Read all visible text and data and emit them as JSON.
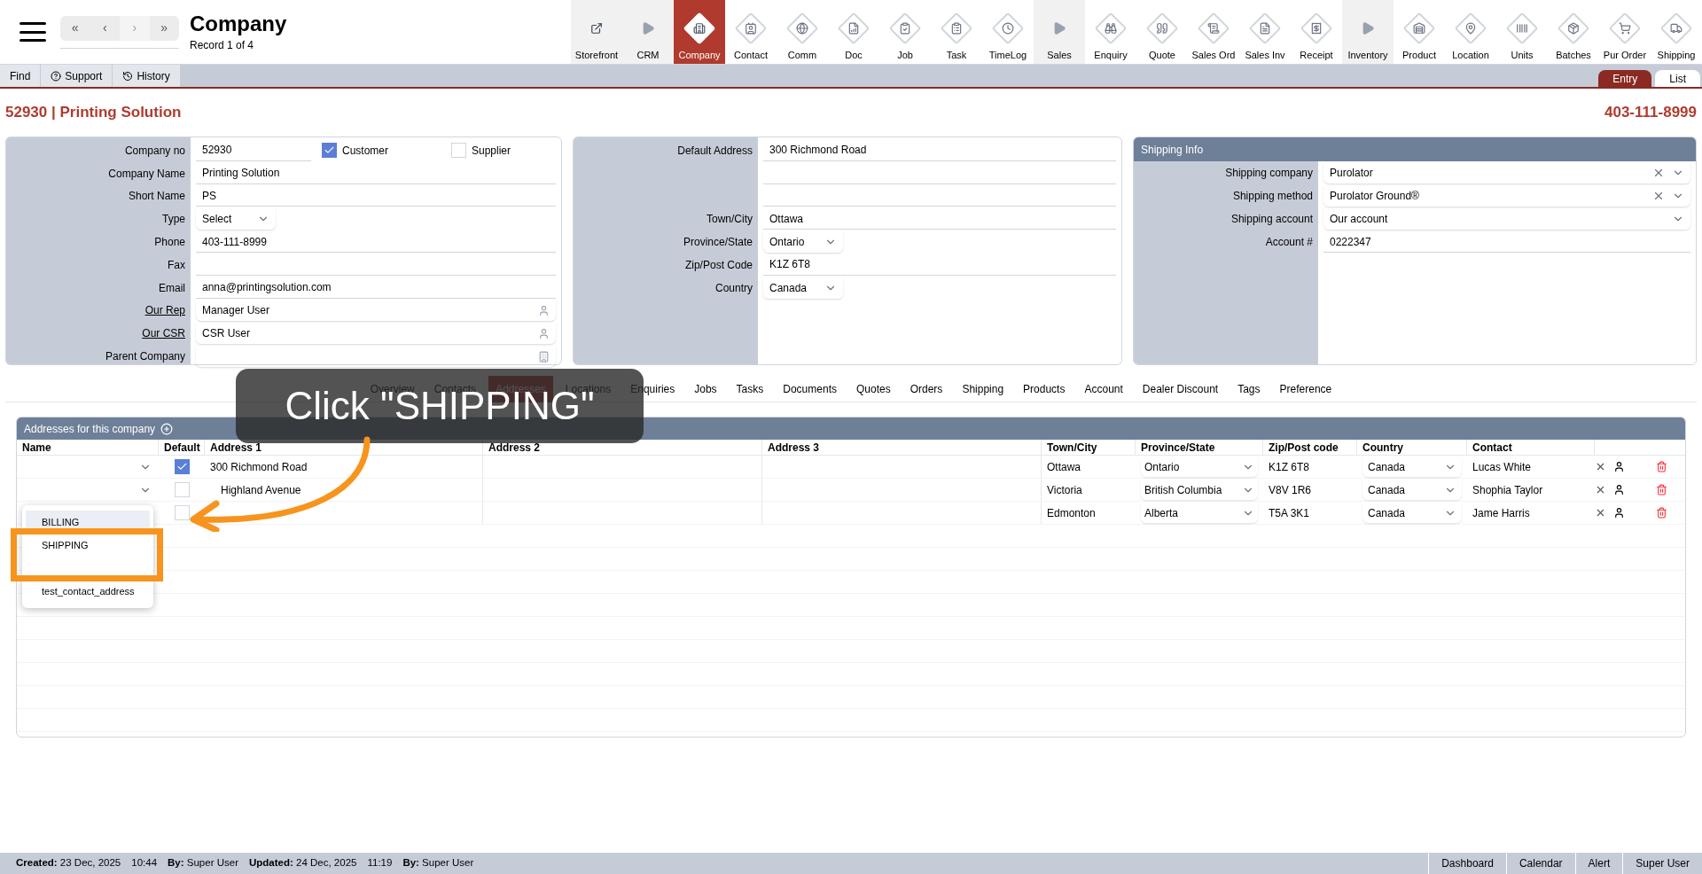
{
  "header": {
    "title": "Company",
    "subtitle": "Record 1 of 4",
    "pager": [
      "«",
      "‹",
      "›",
      "»"
    ]
  },
  "modules": [
    {
      "label": "Storefront",
      "kind": "link",
      "selected": false
    },
    {
      "label": "CRM",
      "kind": "section",
      "selected": false
    },
    {
      "label": "Company",
      "kind": "module",
      "selected": true
    },
    {
      "label": "Contact",
      "kind": "module",
      "selected": false
    },
    {
      "label": "Comm",
      "kind": "module",
      "selected": false
    },
    {
      "label": "Doc",
      "kind": "module",
      "selected": false
    },
    {
      "label": "Job",
      "kind": "module",
      "selected": false
    },
    {
      "label": "Task",
      "kind": "module",
      "selected": false
    },
    {
      "label": "TimeLog",
      "kind": "module",
      "selected": false
    },
    {
      "label": "Sales",
      "kind": "section",
      "selected": false
    },
    {
      "label": "Enquiry",
      "kind": "module",
      "selected": false
    },
    {
      "label": "Quote",
      "kind": "module",
      "selected": false
    },
    {
      "label": "Sales Ord",
      "kind": "module",
      "selected": false
    },
    {
      "label": "Sales Inv",
      "kind": "module",
      "selected": false
    },
    {
      "label": "Receipt",
      "kind": "module",
      "selected": false
    },
    {
      "label": "Inventory",
      "kind": "section",
      "selected": false
    },
    {
      "label": "Product",
      "kind": "module",
      "selected": false
    },
    {
      "label": "Location",
      "kind": "module",
      "selected": false
    },
    {
      "label": "Units",
      "kind": "module",
      "selected": false
    },
    {
      "label": "Batches",
      "kind": "module",
      "selected": false
    },
    {
      "label": "Pur Order",
      "kind": "module",
      "selected": false
    },
    {
      "label": "Shipping",
      "kind": "module",
      "selected": false
    }
  ],
  "toolbar": [
    {
      "label": "Find",
      "kind": "plain"
    },
    {
      "label": "Support",
      "kind": "help"
    },
    {
      "label": "History",
      "kind": "history"
    }
  ],
  "view_tabs": [
    {
      "label": "Entry",
      "selected": true
    },
    {
      "label": "List",
      "selected": false
    }
  ],
  "record": {
    "title": "52930 | Printing Solution",
    "phone": "403-111-8999"
  },
  "company_fields": [
    {
      "label": "Company no",
      "value": "52930",
      "kind": "text"
    },
    {
      "label": "Company Name",
      "value": "Printing Solution",
      "kind": "text"
    },
    {
      "label": "Short Name",
      "value": "PS",
      "kind": "text"
    },
    {
      "label": "Type",
      "value": "Select",
      "kind": "select"
    },
    {
      "label": "Phone",
      "value": "403-111-8999",
      "kind": "text"
    },
    {
      "label": "Fax",
      "kind": "text"
    },
    {
      "label": "Email",
      "value": "anna@printingsolution.com",
      "kind": "text"
    },
    {
      "label": "Our Rep",
      "value": "Manager User",
      "kind": "user",
      "link": true
    },
    {
      "label": "Our CSR",
      "value": "CSR User",
      "kind": "user",
      "link": true
    },
    {
      "label": "Parent Company",
      "kind": "building"
    }
  ],
  "flags": [
    {
      "label": "Customer",
      "checked": true
    },
    {
      "label": "Supplier",
      "checked": false
    }
  ],
  "address_fields": [
    {
      "label": "Default Address",
      "value": "300 Richmond Road",
      "kind": "text"
    },
    {
      "kind": "text"
    },
    {
      "kind": "text"
    },
    {
      "label": "Town/City",
      "value": "Ottawa",
      "kind": "text"
    },
    {
      "label": "Province/State",
      "value": "Ontario",
      "kind": "select"
    },
    {
      "label": "Zip/Post Code",
      "value": "K1Z 6T8",
      "kind": "text"
    },
    {
      "label": "Country",
      "value": "Canada",
      "kind": "select"
    }
  ],
  "shipping_info": {
    "title": "Shipping Info",
    "fields": [
      {
        "label": "Shipping company",
        "value": "Purolator",
        "kind": "clearable"
      },
      {
        "label": "Shipping method",
        "value": "Purolator Ground®",
        "kind": "clearable"
      },
      {
        "label": "Shipping account",
        "value": "Our account",
        "kind": "dropdown"
      },
      {
        "label": "Account #",
        "value": "0222347",
        "kind": "text"
      }
    ]
  },
  "section_tabs": [
    {
      "label": "Overview",
      "selected": false
    },
    {
      "label": "Contacts",
      "selected": false
    },
    {
      "label": "Addresses",
      "selected": true
    },
    {
      "label": "Locations",
      "selected": false
    },
    {
      "label": "Enquiries",
      "selected": false
    },
    {
      "label": "Jobs",
      "selected": false
    },
    {
      "label": "Tasks",
      "selected": false
    },
    {
      "label": "Documents",
      "selected": false
    },
    {
      "label": "Quotes",
      "selected": false
    },
    {
      "label": "Orders",
      "selected": false
    },
    {
      "label": "Shipping",
      "selected": false
    },
    {
      "label": "Products",
      "selected": false
    },
    {
      "label": "Account",
      "selected": false
    },
    {
      "label": "Dealer Discount",
      "selected": false
    },
    {
      "label": "Tags",
      "selected": false
    },
    {
      "label": "Preference",
      "selected": false
    }
  ],
  "addresses": {
    "title": "Addresses for this company",
    "columns": [
      "Name",
      "Default",
      "Address 1",
      "Address 2",
      "Address 3",
      "Town/City",
      "Province/State",
      "Zip/Post code",
      "Country",
      "Contact"
    ],
    "rows": [
      {
        "default": true,
        "address_1": "300 Richmond Road",
        "town": "Ottawa",
        "province": "Ontario",
        "zip": "K1Z 6T8",
        "country": "Canada",
        "contact": "Lucas White"
      },
      {
        "default": false,
        "address_1": "Highland Avenue",
        "town": "Victoria",
        "province": "British Columbia",
        "zip": "V8V 1R6",
        "country": "Canada",
        "contact": "Shophia Taylor"
      },
      {
        "default": false,
        "menu_open": true,
        "town": "Edmonton",
        "province": "Alberta",
        "zip": "T5A 3K1",
        "country": "Canada",
        "contact": "Jame Harris"
      }
    ]
  },
  "name_menu": [
    {
      "label": "BILLING",
      "selected": true
    },
    {
      "label": "SHIPPING",
      "selected": false
    },
    {
      "label": "test_contact_address",
      "selected": false
    }
  ],
  "callout": {
    "text": "Click \"SHIPPING\""
  },
  "footer": {
    "meta": [
      {
        "label": "Created:",
        "value": "23 Dec, 2025"
      },
      {
        "value": "10:44"
      },
      {
        "label": "By:",
        "value": "Super User"
      },
      {
        "label": "Updated:",
        "value": "24 Dec, 2025"
      },
      {
        "value": "11:19"
      },
      {
        "label": "By:",
        "value": "Super User"
      }
    ],
    "links": [
      "Dashboard",
      "Calendar",
      "Alert",
      "Super User"
    ]
  }
}
